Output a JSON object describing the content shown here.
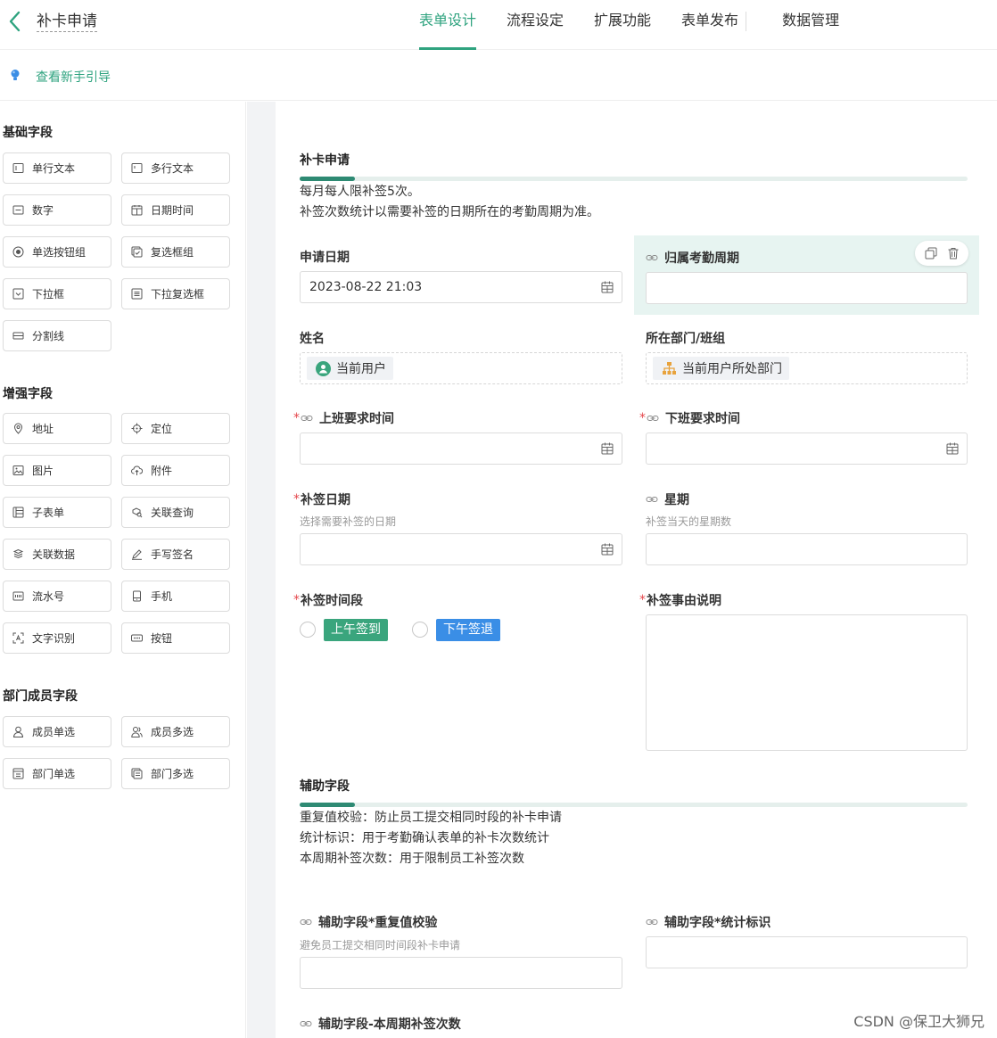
{
  "header": {
    "app_title": "补卡申请",
    "tabs": [
      "表单设计",
      "流程设定",
      "扩展功能",
      "表单发布",
      "数据管理"
    ]
  },
  "guide": {
    "text": "查看新手引导"
  },
  "sidebar": {
    "basic_title": "基础字段",
    "basic": [
      "单行文本",
      "多行文本",
      "数字",
      "日期时间",
      "单选按钮组",
      "复选框组",
      "下拉框",
      "下拉复选框",
      "分割线"
    ],
    "enhanced_title": "增强字段",
    "enhanced": [
      "地址",
      "定位",
      "图片",
      "附件",
      "子表单",
      "关联查询",
      "关联数据",
      "手写签名",
      "流水号",
      "手机",
      "文字识别",
      "按钮"
    ],
    "member_title": "部门成员字段",
    "member": [
      "成员单选",
      "成员多选",
      "部门单选",
      "部门多选"
    ]
  },
  "form": {
    "section1": {
      "title": "补卡申请",
      "desc": [
        "每月每人限补签5次。",
        "补签次数统计以需要补签的日期所在的考勤周期为准。"
      ]
    },
    "apply_date": {
      "label": "申请日期",
      "value": "2023-08-22 21:03"
    },
    "period": {
      "label": "归属考勤周期"
    },
    "name": {
      "label": "姓名",
      "chip": "当前用户"
    },
    "dept": {
      "label": "所在部门/班组",
      "chip": "当前用户所处部门"
    },
    "start_time": {
      "req": "*",
      "label": "上班要求时间"
    },
    "end_time": {
      "req": "*",
      "label": "下班要求时间"
    },
    "sign_date": {
      "req": "*",
      "label": "补签日期",
      "hint": "选择需要补签的日期"
    },
    "weekday": {
      "label": "星期",
      "hint": "补签当天的星期数"
    },
    "sign_slot": {
      "req": "*",
      "label": "补签时间段",
      "options": [
        "上午签到",
        "下午签退"
      ]
    },
    "reason": {
      "req": "*",
      "label": "补签事由说明"
    },
    "section2": {
      "title": "辅助字段",
      "desc": [
        "重复值校验：防止员工提交相同时段的补卡申请",
        "统计标识：用于考勤确认表单的补卡次数统计",
        "本周期补签次数：用于限制员工补签次数"
      ]
    },
    "aux_dup": {
      "label": "辅助字段*重复值校验",
      "hint": "避免员工提交相同时间段补卡申请"
    },
    "aux_stat": {
      "label": "辅助字段*统计标识"
    },
    "aux_count": {
      "label": "辅助字段-本周期补签次数"
    }
  },
  "watermark": "CSDN @保卫大狮兄",
  "colors": {
    "accent": "#2fa37f",
    "tag_green": "#3aa57d",
    "tag_blue": "#3a8ee6"
  }
}
